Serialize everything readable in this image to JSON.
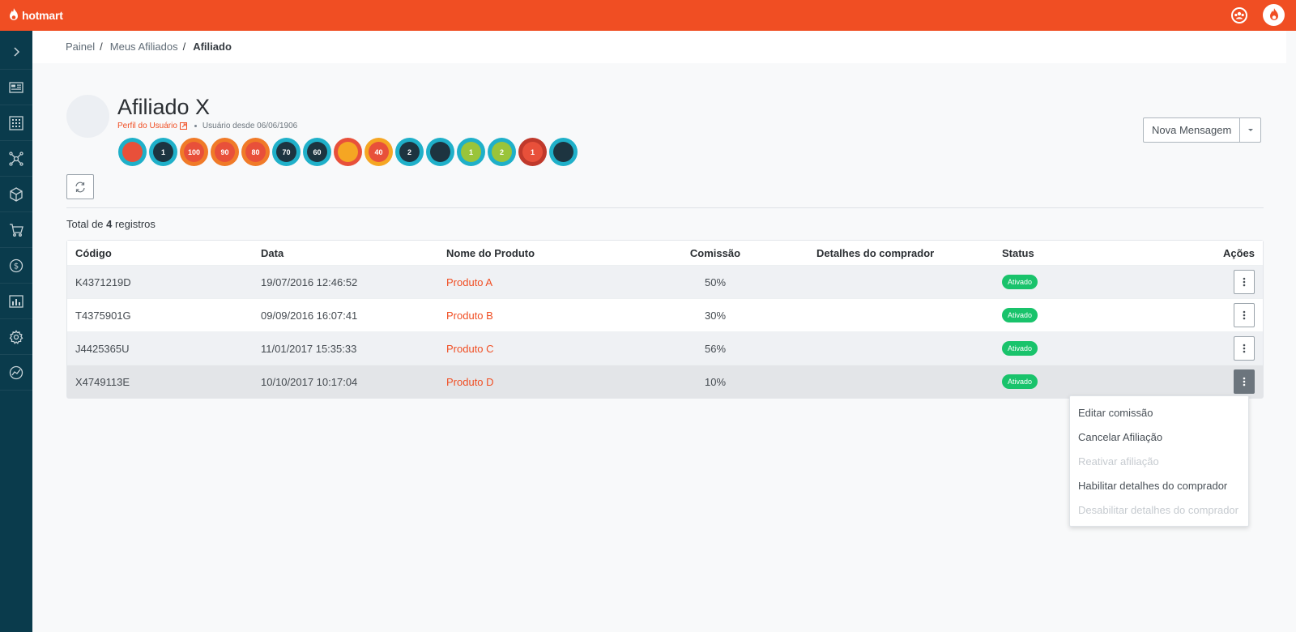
{
  "app": {
    "brand": "hotmart",
    "colors": {
      "accent": "#f04e23",
      "sidebar": "#0a3b4c",
      "success": "#19c36b"
    }
  },
  "topbar": {
    "icons": [
      "hotmart-flame-logo",
      "users-group-icon",
      "hotmart-avatar-logo"
    ]
  },
  "sidebar": {
    "items": [
      {
        "icon": "chevron-right-icon"
      },
      {
        "icon": "dashboard-icon"
      },
      {
        "icon": "apps-grid-icon"
      },
      {
        "icon": "network-icon"
      },
      {
        "icon": "box-icon"
      },
      {
        "icon": "cart-icon"
      },
      {
        "icon": "dollar-icon"
      },
      {
        "icon": "bar-chart-icon"
      },
      {
        "icon": "gear-icon"
      },
      {
        "icon": "trend-icon"
      }
    ]
  },
  "breadcrumb": {
    "items": [
      "Painel",
      "Meus Afiliados"
    ],
    "separator": "/",
    "current": "Afiliado"
  },
  "profile": {
    "name": "Afiliado X",
    "profile_link": "Perfil do Usuário",
    "since": "Usuário desde 06/06/1906",
    "badges": [
      {
        "label": "",
        "color": "#e8503a",
        "ring": "#1fb0c9"
      },
      {
        "label": "1",
        "color": "#1d3440",
        "ring": "#1fb0c9"
      },
      {
        "label": "100",
        "color": "#e8503a",
        "ring": "#f07a28"
      },
      {
        "label": "90",
        "color": "#e8503a",
        "ring": "#f07a28"
      },
      {
        "label": "80",
        "color": "#e8503a",
        "ring": "#f07a28"
      },
      {
        "label": "70",
        "color": "#1d3440",
        "ring": "#1fb0c9"
      },
      {
        "label": "60",
        "color": "#1d3440",
        "ring": "#1fb0c9"
      },
      {
        "label": "",
        "color": "#f5a623",
        "ring": "#e8503a"
      },
      {
        "label": "40",
        "color": "#e8503a",
        "ring": "#f5a623"
      },
      {
        "label": "2",
        "color": "#1d3440",
        "ring": "#1fb0c9"
      },
      {
        "label": "",
        "color": "#1d3440",
        "ring": "#1fb0c9"
      },
      {
        "label": "1",
        "color": "#9ac43a",
        "ring": "#1fb0c9"
      },
      {
        "label": "2",
        "color": "#9ac43a",
        "ring": "#1fb0c9"
      },
      {
        "label": "1",
        "color": "#e8503a",
        "ring": "#c0392b"
      },
      {
        "label": "",
        "color": "#1d3440",
        "ring": "#1fb0c9"
      }
    ]
  },
  "actions": {
    "new_message": "Nova Mensagem"
  },
  "summary": {
    "prefix": "Total de",
    "count": "4",
    "suffix": "registros"
  },
  "table": {
    "columns": {
      "code": "Código",
      "date": "Data",
      "product": "Nome do Produto",
      "commission": "Comissão",
      "buyer_details": "Detalhes do comprador",
      "status": "Status",
      "actions": "Ações"
    },
    "rows": [
      {
        "code": "K4371219D",
        "date": "19/07/2016 12:46:52",
        "product": "Produto A",
        "commission": "50%",
        "buyer_details": "",
        "status": "Ativado"
      },
      {
        "code": "T4375901G",
        "date": "09/09/2016 16:07:41",
        "product": "Produto B",
        "commission": "30%",
        "buyer_details": "",
        "status": "Ativado"
      },
      {
        "code": "J4425365U",
        "date": "11/01/2017 15:35:33",
        "product": "Produto C",
        "commission": "56%",
        "buyer_details": "",
        "status": "Ativado"
      },
      {
        "code": "X4749113E",
        "date": "10/10/2017 10:17:04",
        "product": "Produto D",
        "commission": "10%",
        "buyer_details": "",
        "status": "Ativado"
      }
    ]
  },
  "row_menu": {
    "items": [
      {
        "label": "Editar comissão",
        "enabled": true
      },
      {
        "label": "Cancelar Afiliação",
        "enabled": true
      },
      {
        "label": "Reativar afiliação",
        "enabled": false
      },
      {
        "label": "Habilitar detalhes do comprador",
        "enabled": true
      },
      {
        "label": "Desabilitar detalhes do comprador",
        "enabled": false
      }
    ]
  }
}
